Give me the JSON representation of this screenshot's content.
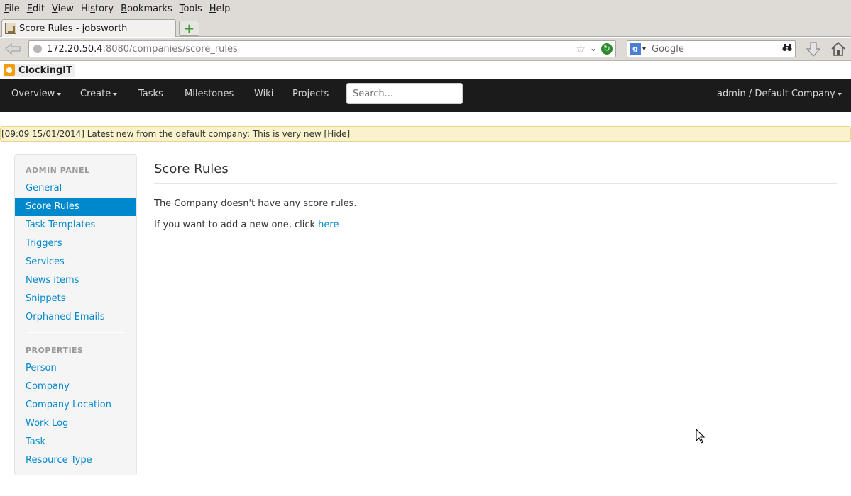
{
  "menu": {
    "items": [
      {
        "label": "File",
        "key": "F",
        "rest": "ile"
      },
      {
        "label": "Edit",
        "key": "E",
        "rest": "dit"
      },
      {
        "label": "View",
        "key": "V",
        "rest": "iew"
      },
      {
        "label": "History",
        "key": "s",
        "pre": "Hi",
        "rest": "tory"
      },
      {
        "label": "Bookmarks",
        "key": "B",
        "rest": "ookmarks"
      },
      {
        "label": "Tools",
        "key": "T",
        "rest": "ools"
      },
      {
        "label": "Help",
        "key": "H",
        "rest": "elp"
      }
    ]
  },
  "tab": {
    "title": "Score Rules - jobsworth",
    "new_tab": "+"
  },
  "urlbar": {
    "host": "172.20.50.4",
    "path": ":8080/companies/score_rules"
  },
  "searchbar": {
    "engine": "g",
    "placeholder": "Google"
  },
  "app": {
    "brand": "ClockingIT"
  },
  "topnav": {
    "overview": "Overview",
    "create": "Create",
    "tasks": "Tasks",
    "milestones": "Milestones",
    "wiki": "Wiki",
    "projects": "Projects",
    "search_placeholder": "Search...",
    "user": "admin / Default Company"
  },
  "news": {
    "text": "[09:09 15/01/2014] Latest new from the default company: This is very new [Hide]"
  },
  "sidebar": {
    "admin_header": "ADMIN PANEL",
    "admin_items": [
      "General",
      "Score Rules",
      "Task Templates",
      "Triggers",
      "Services",
      "News items",
      "Snippets",
      "Orphaned Emails"
    ],
    "active": "Score Rules",
    "properties_header": "PROPERTIES",
    "property_items": [
      "Person",
      "Company",
      "Company Location",
      "Work Log",
      "Task",
      "Resource Type"
    ]
  },
  "main": {
    "title": "Score Rules",
    "empty_text": "The Company doesn't have any score rules.",
    "add_prefix": "If you want to add a new one, click ",
    "add_link": "here"
  }
}
